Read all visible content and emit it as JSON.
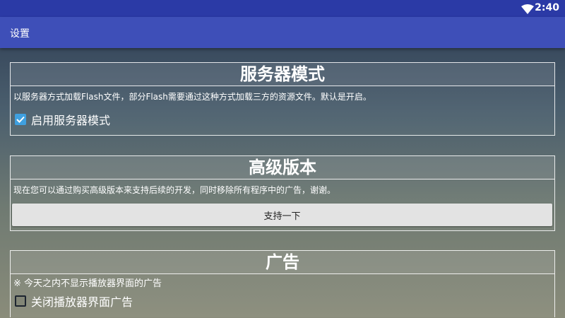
{
  "status_bar": {
    "time": "2:40",
    "wifi_icon": "wifi-icon"
  },
  "app_bar": {
    "title": "设置"
  },
  "server_mode": {
    "heading": "服务器模式",
    "description": "以服务器方式加载Flash文件，部分Flash需要通过这种方式加载三方的资源文件。默认是开启。",
    "checkbox_label": "启用服务器模式",
    "checked": true
  },
  "premium": {
    "heading": "高级版本",
    "description": "现在您可以通过购买高级版本来支持后续的开发，同时移除所有程序中的广告，谢谢。",
    "button_label": "支持一下"
  },
  "ads": {
    "heading": "广告",
    "note": "※ 今天之内不显示播放器界面的广告",
    "checkbox_label": "关闭播放器界面广告",
    "checked": false
  },
  "colors": {
    "status_bar": "#2b3aa6",
    "app_bar": "#3e4fb8",
    "checkbox_on": "#3fa0e0"
  }
}
